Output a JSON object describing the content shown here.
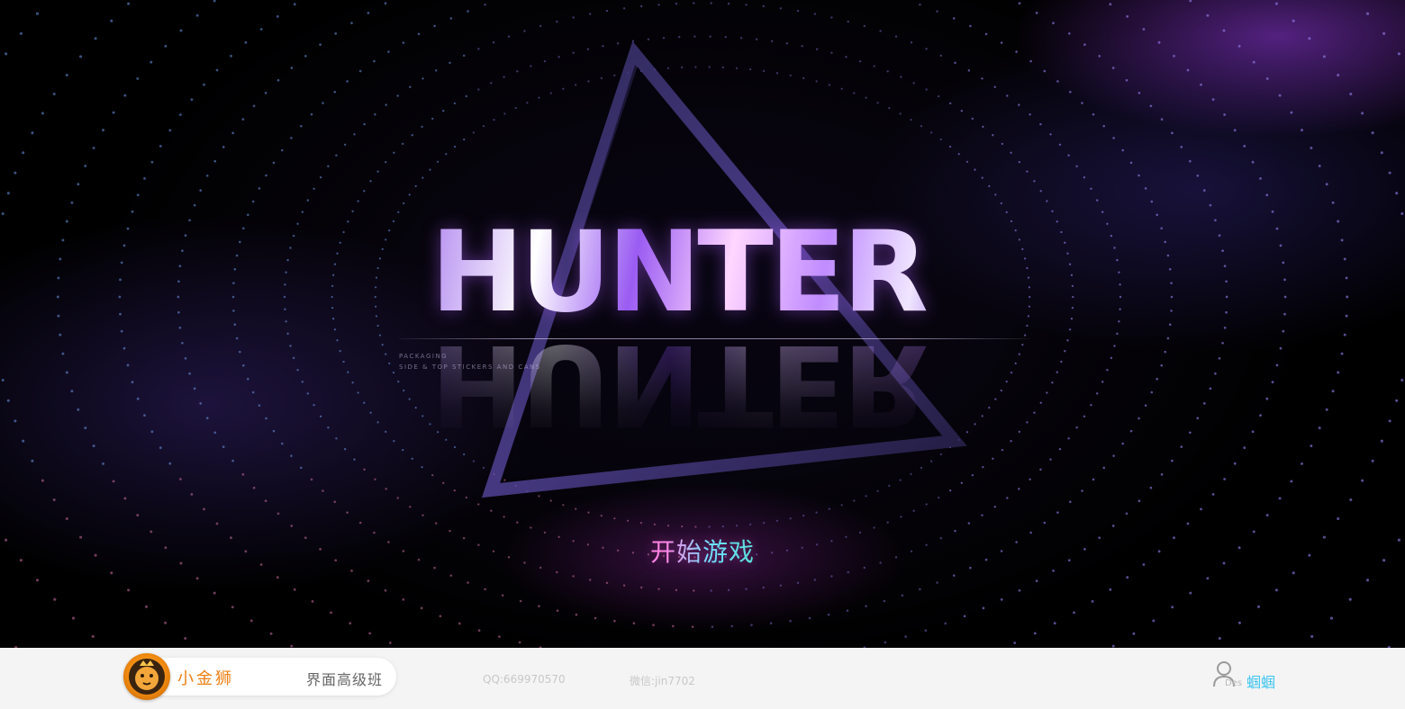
{
  "game": {
    "title": "HUNTER",
    "tagline_1": "PACKAGING",
    "tagline_2": "SIDE & TOP STICKERS AND CANS",
    "start_button": "开始游戏"
  },
  "footer": {
    "brand_name": "小金狮",
    "course_name": "界面高级班",
    "qq": "QQ:669970570",
    "wechat": "微信:jin7702",
    "des_label": "Des",
    "author": "蝈蝈"
  },
  "colors": {
    "brand_orange": "#ef7f12",
    "author_blue": "#3cc4f0",
    "accent_purple": "#9a5cf2",
    "start_pink": "#ff7ae0",
    "start_cyan": "#4fe0c8"
  },
  "icons": [
    "lion-logo-icon",
    "user-icon"
  ]
}
